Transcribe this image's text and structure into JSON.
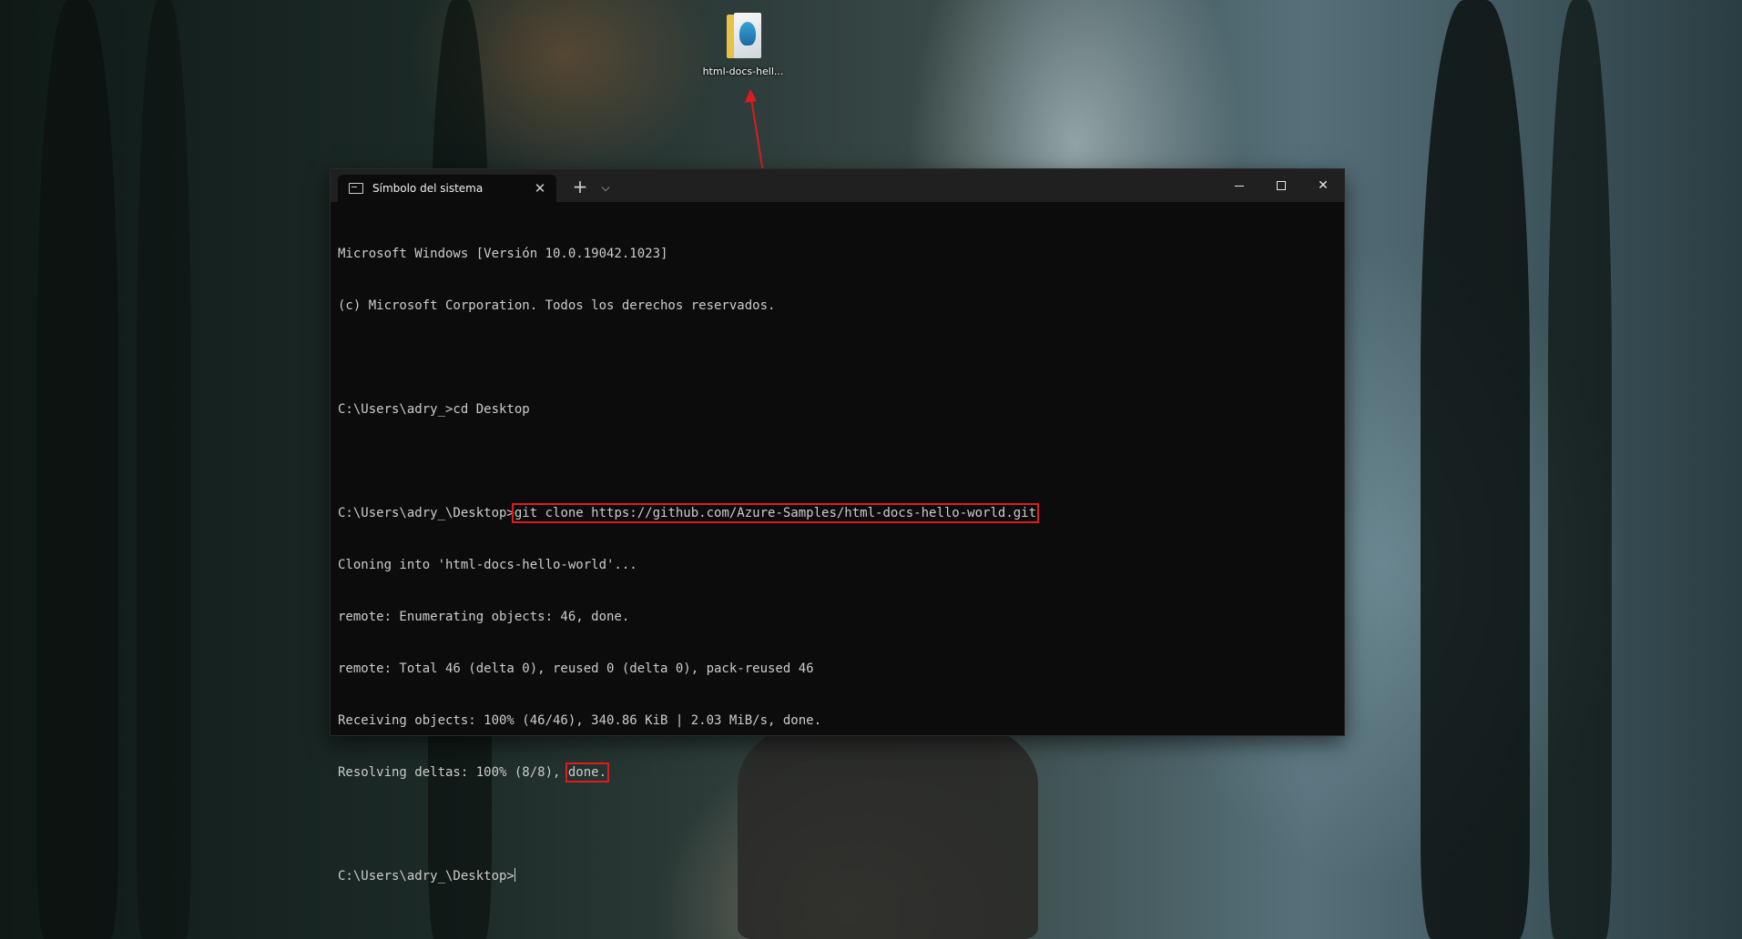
{
  "desktop": {
    "icon_label": "html-docs-hell..."
  },
  "window": {
    "tab_title": "Símbolo del sistema",
    "tab_close": "✕",
    "new_tab": "+",
    "dropdown": "⌵",
    "close": "✕"
  },
  "console": {
    "lines": [
      "Microsoft Windows [Versión 10.0.19042.1023]",
      "(c) Microsoft Corporation. Todos los derechos reservados.",
      "",
      "C:\\Users\\adry_>cd Desktop",
      "",
      "C:\\Users\\adry_\\Desktop>",
      "Cloning into 'html-docs-hello-world'...",
      "remote: Enumerating objects: 46, done.",
      "remote: Total 46 (delta 0), reused 0 (delta 0), pack-reused 46",
      "Receiving objects: 100% (46/46), 340.86 KiB | 2.03 MiB/s, done.",
      "Resolving deltas: 100% (8/8), ",
      "",
      "C:\\Users\\adry_\\Desktop>"
    ],
    "git_command": "git clone https://github.com/Azure-Samples/html-docs-hello-world.git",
    "done_text": "done."
  },
  "colors": {
    "highlight": "#e01b1b",
    "console_bg": "#0c0c0c",
    "console_text": "#cccccc"
  }
}
